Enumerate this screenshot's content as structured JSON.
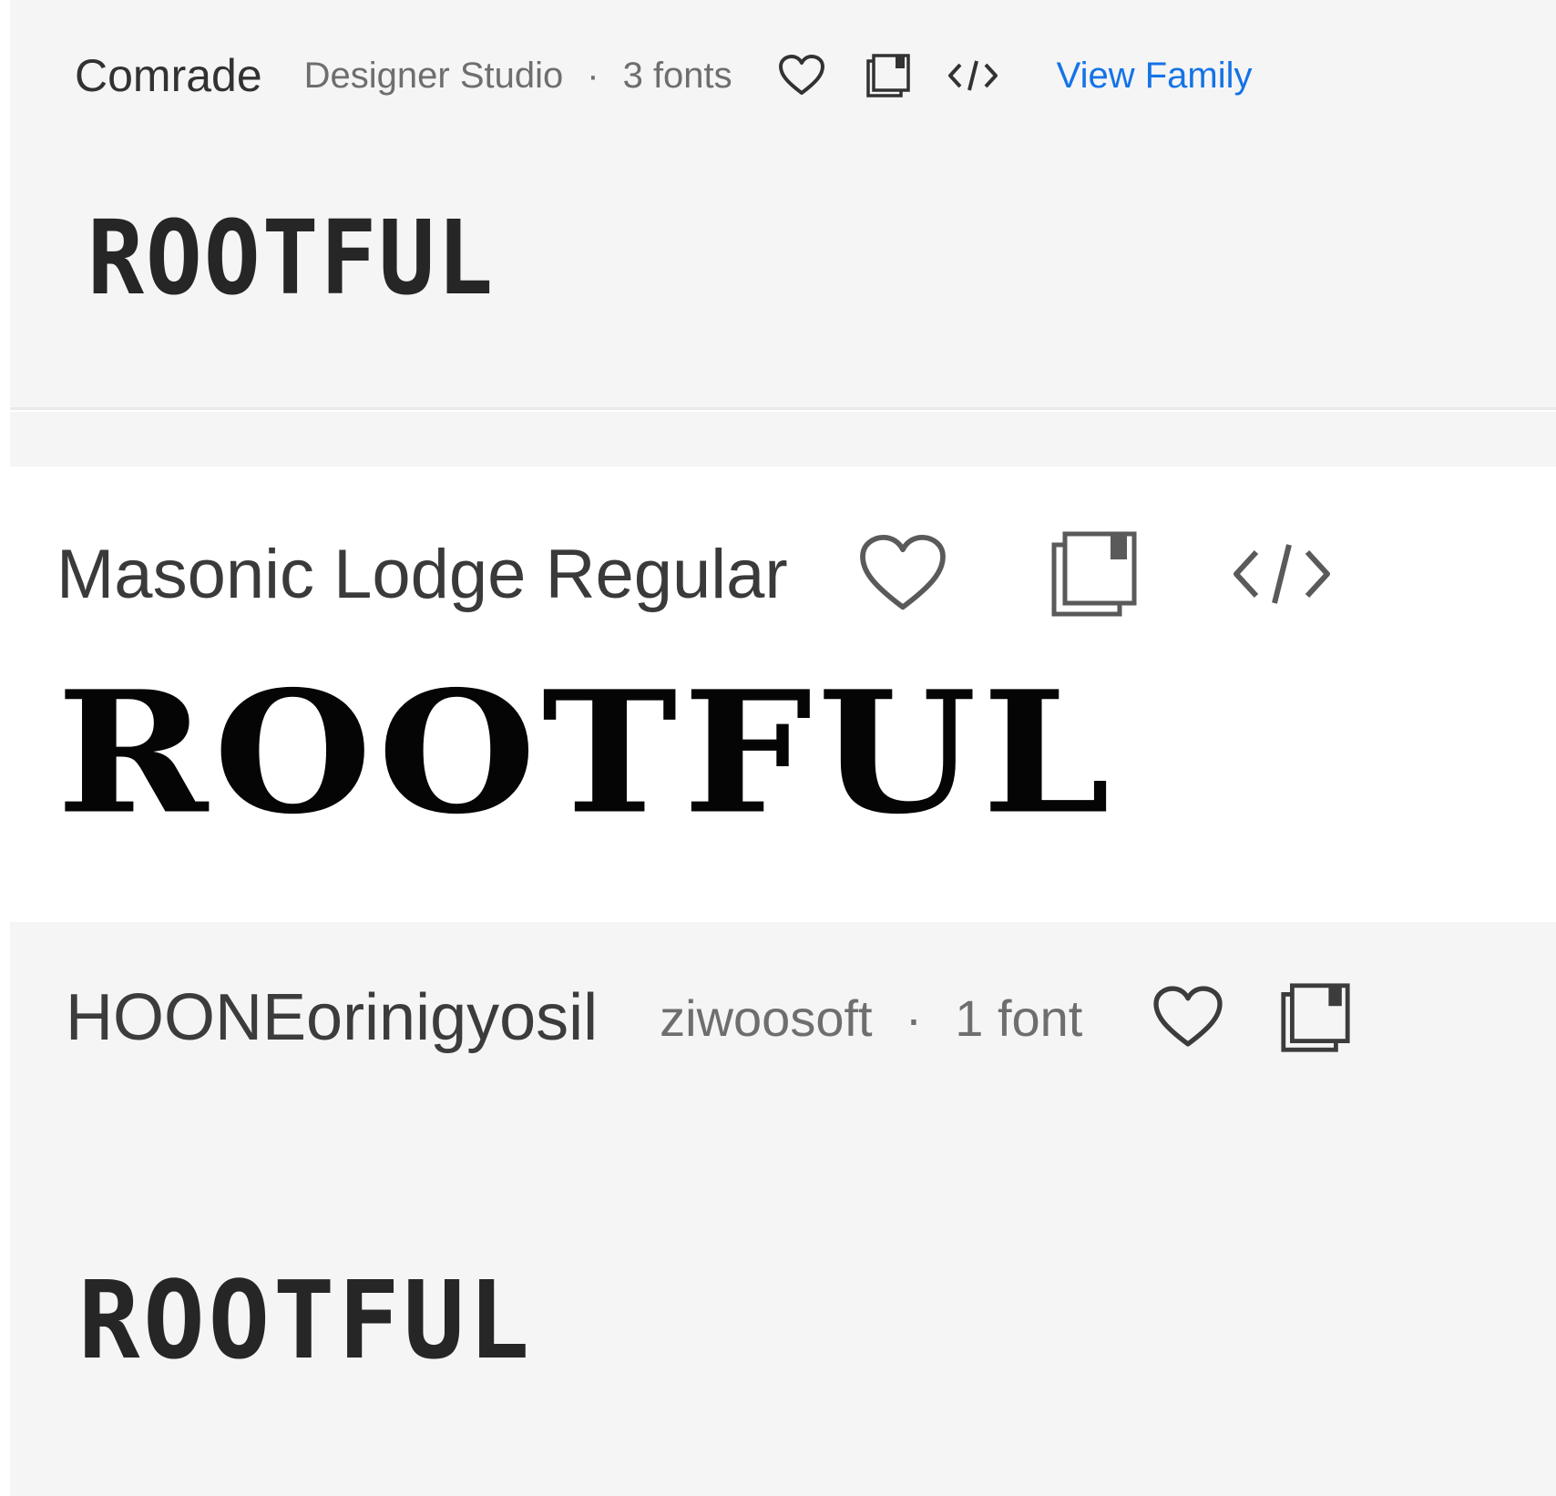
{
  "colors": {
    "card_gray": "#f5f5f5",
    "card_white": "#ffffff",
    "text_primary": "#323232",
    "text_meta": "#6e6e6e",
    "link_blue": "#1473e6"
  },
  "cards": [
    {
      "family_name": "Comrade",
      "foundry": "Designer Studio",
      "separator": "·",
      "font_count": "3 fonts",
      "view_family_label": "View Family",
      "sample_text": "ROOTFUL",
      "icons": [
        "heart-icon",
        "copy-icon",
        "code-icon"
      ]
    },
    {
      "family_name": "Masonic Lodge Regular",
      "sample_text": "ROOTFUL",
      "icons": [
        "heart-icon",
        "copy-icon",
        "code-icon"
      ]
    },
    {
      "family_name": "HOONEorinigyosil",
      "foundry": "ziwoosoft",
      "separator": "·",
      "font_count": "1 font",
      "sample_text": "ROOTFUL",
      "icons": [
        "heart-icon",
        "copy-icon"
      ]
    }
  ]
}
